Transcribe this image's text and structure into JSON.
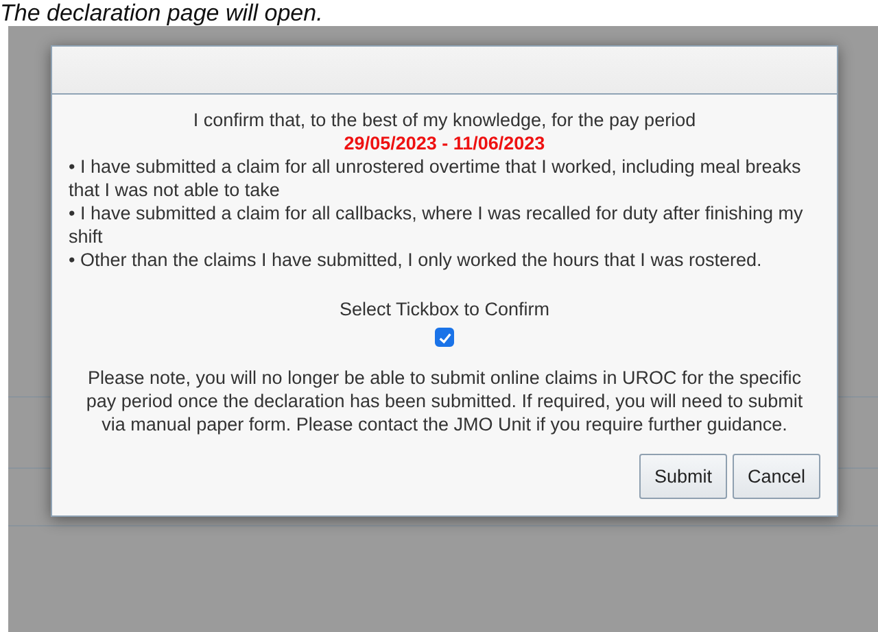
{
  "caption": "The declaration page will open.",
  "dialog": {
    "intro": "I confirm that, to the best of my knowledge, for the pay period",
    "period": "29/05/2023 - 11/06/2023",
    "statements": [
      "• I have submitted a claim for all unrostered overtime that I worked, including meal breaks that I was not able to take",
      "• I have submitted a claim for all callbacks, where I was recalled for duty after finishing my shift",
      "• Other than the claims I have submitted, I only worked the hours that I was rostered."
    ],
    "confirm_label": "Select Tickbox to Confirm",
    "confirm": {
      "checked": true
    },
    "note": "Please note, you will no longer be able to submit online claims in UROC for the specific pay period once the declaration has been submitted. If required, you will need to submit via manual paper form. Please contact the JMO Unit if you require further guidance.",
    "buttons": [
      "Submit",
      "Cancel"
    ]
  }
}
